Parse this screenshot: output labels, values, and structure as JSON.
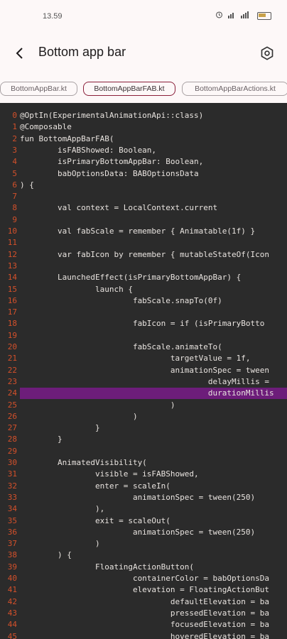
{
  "status_bar": {
    "time": "13.59",
    "icons": [
      "alarm-icon",
      "wifi-icon",
      "signal-icon",
      "battery-icon"
    ],
    "signal_text": "ᵛᵒ⁴ˡˡ ᵛᵒ⁴ˡˡ"
  },
  "app_bar": {
    "title": "Bottom app bar",
    "back_icon": "arrow-back-icon",
    "action_icon": "settings-icon"
  },
  "tabs": [
    {
      "label": "BottomAppBar.kt",
      "selected": false
    },
    {
      "label": "BottomAppBarFAB.kt",
      "selected": true
    },
    {
      "label": "BottomAppBarActions.kt",
      "selected": false
    }
  ],
  "colors": {
    "accent": "#8a1f3a",
    "code_bg": "#2b2b2b",
    "line_number": "#d4502a",
    "highlight": "#6d1d7a",
    "code_text": "#e8e3df"
  },
  "code": {
    "highlighted_line": 24,
    "lines": [
      {
        "n": "0",
        "text": "@OptIn(ExperimentalAnimationApi::class)"
      },
      {
        "n": "1",
        "text": "@Composable"
      },
      {
        "n": "2",
        "text": "fun BottomAppBarFAB("
      },
      {
        "n": "3",
        "text": "        isFABShowed: Boolean,"
      },
      {
        "n": "4",
        "text": "        isPrimaryBottomAppBar: Boolean,"
      },
      {
        "n": "5",
        "text": "        babOptionsData: BABOptionsData"
      },
      {
        "n": "6",
        "text": ") {"
      },
      {
        "n": "7",
        "text": ""
      },
      {
        "n": "8",
        "text": "        val context = LocalContext.current"
      },
      {
        "n": "9",
        "text": ""
      },
      {
        "n": "10",
        "text": "        val fabScale = remember { Animatable(1f) }"
      },
      {
        "n": "11",
        "text": ""
      },
      {
        "n": "12",
        "text": "        var fabIcon by remember { mutableStateOf(Icon"
      },
      {
        "n": "13",
        "text": ""
      },
      {
        "n": "14",
        "text": "        LaunchedEffect(isPrimaryBottomAppBar) {"
      },
      {
        "n": "15",
        "text": "                launch {"
      },
      {
        "n": "16",
        "text": "                        fabScale.snapTo(0f)"
      },
      {
        "n": "17",
        "text": ""
      },
      {
        "n": "18",
        "text": "                        fabIcon = if (isPrimaryBotto"
      },
      {
        "n": "19",
        "text": ""
      },
      {
        "n": "20",
        "text": "                        fabScale.animateTo("
      },
      {
        "n": "21",
        "text": "                                targetValue = 1f,"
      },
      {
        "n": "22",
        "text": "                                animationSpec = tween"
      },
      {
        "n": "23",
        "text": "                                        delayMillis ="
      },
      {
        "n": "24",
        "text": "                                        durationMillis"
      },
      {
        "n": "25",
        "text": "                                )"
      },
      {
        "n": "26",
        "text": "                        )"
      },
      {
        "n": "27",
        "text": "                }"
      },
      {
        "n": "28",
        "text": "        }"
      },
      {
        "n": "29",
        "text": ""
      },
      {
        "n": "30",
        "text": "        AnimatedVisibility("
      },
      {
        "n": "31",
        "text": "                visible = isFABShowed,"
      },
      {
        "n": "32",
        "text": "                enter = scaleIn("
      },
      {
        "n": "33",
        "text": "                        animationSpec = tween(250)"
      },
      {
        "n": "34",
        "text": "                ),"
      },
      {
        "n": "35",
        "text": "                exit = scaleOut("
      },
      {
        "n": "36",
        "text": "                        animationSpec = tween(250)"
      },
      {
        "n": "37",
        "text": "                )"
      },
      {
        "n": "38",
        "text": "        ) {"
      },
      {
        "n": "39",
        "text": "                FloatingActionButton("
      },
      {
        "n": "40",
        "text": "                        containerColor = babOptionsDa"
      },
      {
        "n": "41",
        "text": "                        elevation = FloatingActionBut"
      },
      {
        "n": "42",
        "text": "                                defaultElevation = ba"
      },
      {
        "n": "43",
        "text": "                                pressedElevation = ba"
      },
      {
        "n": "44",
        "text": "                                focusedElevation = ba"
      },
      {
        "n": "45",
        "text": "                                hoveredElevation = ba"
      }
    ]
  }
}
